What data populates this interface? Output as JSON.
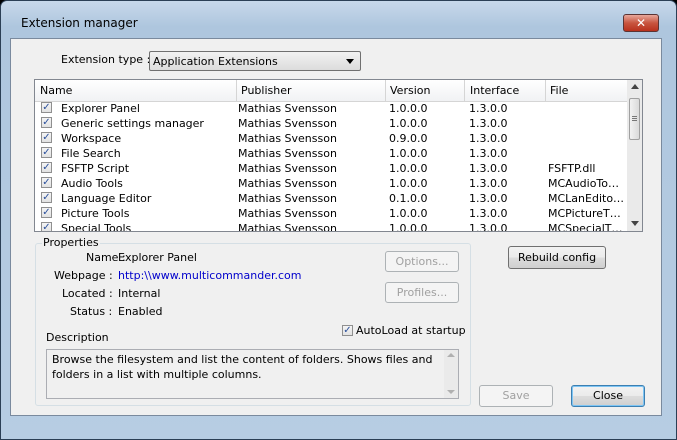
{
  "window": {
    "title": "Extension manager",
    "close_glyph": "✕"
  },
  "ext_type": {
    "label": "Extension type :",
    "value": "Application Extensions"
  },
  "list": {
    "columns": [
      "Name",
      "Publisher",
      "Version",
      "Interface",
      "File"
    ],
    "rows": [
      {
        "name": "Explorer Panel",
        "publisher": "Mathias Svensson",
        "version": "1.0.0.0",
        "interface": "1.3.0.0",
        "file": ""
      },
      {
        "name": "Generic settings manager",
        "publisher": "Mathias Svensson",
        "version": "1.0.0.0",
        "interface": "1.3.0.0",
        "file": ""
      },
      {
        "name": "Workspace",
        "publisher": "Mathias Svensson",
        "version": "0.9.0.0",
        "interface": "1.3.0.0",
        "file": ""
      },
      {
        "name": "File Search",
        "publisher": "Mathias Svensson",
        "version": "1.0.0.0",
        "interface": "1.3.0.0",
        "file": ""
      },
      {
        "name": "FSFTP Script",
        "publisher": "Mathias Svensson",
        "version": "1.0.0.0",
        "interface": "1.3.0.0",
        "file": "FSFTP.dll"
      },
      {
        "name": "Audio Tools",
        "publisher": "Mathias Svensson",
        "version": "1.0.0.0",
        "interface": "1.3.0.0",
        "file": "MCAudioTo…"
      },
      {
        "name": "Language Editor",
        "publisher": "Mathias Svensson",
        "version": "0.1.0.0",
        "interface": "1.3.0.0",
        "file": "MCLanEdito…"
      },
      {
        "name": "Picture Tools",
        "publisher": "Mathias Svensson",
        "version": "1.0.0.0",
        "interface": "1.3.0.0",
        "file": "MCPictureT…"
      },
      {
        "name": "Special Tools",
        "publisher": "Mathias Svensson",
        "version": "1.0.0.0",
        "interface": "1.3.0.0",
        "file": "MCSpecialT…"
      }
    ],
    "checked": true
  },
  "properties": {
    "group_label": "Properties",
    "name_label": "Name :",
    "name_value": "Explorer Panel",
    "webpage_label": "Webpage :",
    "webpage_value": "http:\\\\www.multicommander.com",
    "located_label": "Located :",
    "located_value": "Internal",
    "status_label": "Status :",
    "status_value": "Enabled",
    "options_button": "Options...",
    "profiles_button": "Profiles...",
    "autoload_label": "AutoLoad at startup",
    "autoload_checked": true,
    "description_label": "Description",
    "description_text": "Browse the filesystem and list the content of folders. Shows files and folders in a list with multiple columns."
  },
  "buttons": {
    "rebuild": "Rebuild config",
    "save": "Save",
    "close": "Close"
  },
  "colors": {
    "link": "#0000cc",
    "disabled_text": "#a0a0a0"
  }
}
